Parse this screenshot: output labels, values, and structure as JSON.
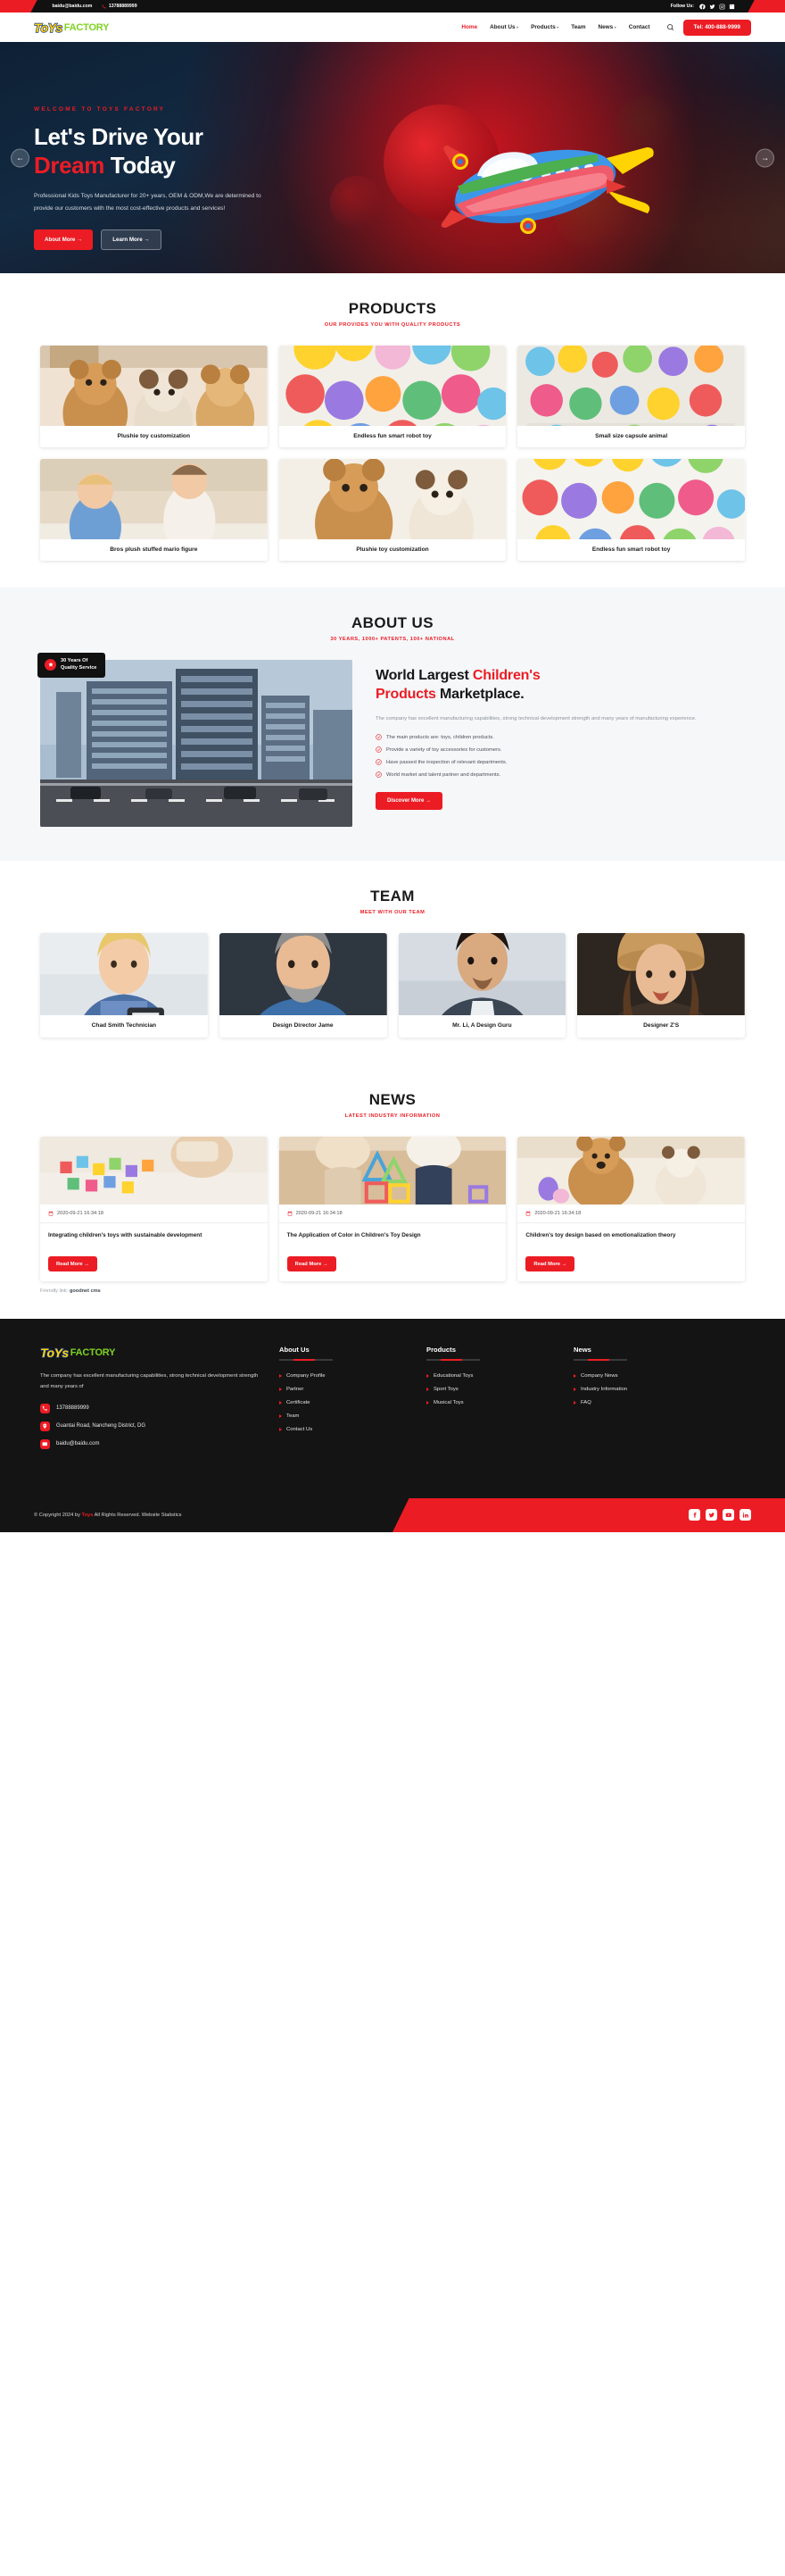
{
  "topbar": {
    "email": "baidu@baidu.com",
    "phone": "13788889999",
    "follow_label": "Follow Us:",
    "socials": [
      "facebook-icon",
      "twitter-icon",
      "instagram-icon",
      "linkedin-icon"
    ]
  },
  "nav": {
    "logo_toys": "ToYs",
    "logo_factory": "FACTORY",
    "items": [
      {
        "label": "Home",
        "has_caret": false,
        "active": true
      },
      {
        "label": "About Us",
        "has_caret": true,
        "active": false
      },
      {
        "label": "Products",
        "has_caret": true,
        "active": false
      },
      {
        "label": "Team",
        "has_caret": false,
        "active": false
      },
      {
        "label": "News",
        "has_caret": true,
        "active": false
      },
      {
        "label": "Contact",
        "has_caret": false,
        "active": false
      }
    ],
    "tel_button": "Tel: 400-888-9999"
  },
  "hero": {
    "eyebrow": "WELCOME TO TOYS FACTORY",
    "title_line1": "Let's Drive Your",
    "title_red": "Dream",
    "title_rest": " Today",
    "paragraph": "Professional Kids Toys Manufacturer for 20+ years, OEM & ODM,We are determined to provide our customers with the most cost-effective products and services!",
    "btn_primary": "About More →",
    "btn_ghost": "Learn More →",
    "prev_icon": "arrow-left-icon",
    "next_icon": "arrow-right-icon"
  },
  "products": {
    "title": "PRODUCTS",
    "subtitle": "OUR PROVIDES YOU WITH QUALITY PRODUCTS",
    "items": [
      {
        "caption": "Plushie toy customization"
      },
      {
        "caption": "Endless fun smart robot toy"
      },
      {
        "caption": "Small size capsule animal"
      },
      {
        "caption": "Bros plush stuffed mario figure"
      },
      {
        "caption": "Plushie toy customization"
      },
      {
        "caption": "Endless fun smart robot toy"
      }
    ]
  },
  "about": {
    "title": "ABOUT US",
    "subtitle": "30 YEARS, 1000+ PATENTS, 100+ NATIONAL",
    "badge_line1": "30 Years Of",
    "badge_line2": "Quality Service",
    "heading_1": "World Largest ",
    "heading_red_1": "Children's",
    "heading_red_2": "Products",
    "heading_2": " Marketplace.",
    "paragraph": "The company has excellent manufacturing capabilities, strong technical development strength and many years of manufacturing experience.",
    "bullets": [
      "The main products are: toys, children products.",
      "Provide a variety of toy accessories for customers.",
      "Have passed the inspection of relevant departments.",
      "World market and talent partner and departments."
    ],
    "button": "Discover More →"
  },
  "team": {
    "title": "TEAM",
    "subtitle": "MEET WITH OUR TEAM",
    "members": [
      {
        "name": "Chad Smith Technician"
      },
      {
        "name": "Design Director Jame"
      },
      {
        "name": "Mr. Li, A Design Guru"
      },
      {
        "name": "Designer Z'S"
      }
    ]
  },
  "news": {
    "title": "NEWS",
    "subtitle": "LATEST INDUSTRY INFORMATION",
    "items": [
      {
        "date": "2020-09-21 16:34:18",
        "title": "Integrating children's toys with sustainable development",
        "button": "Read More →"
      },
      {
        "date": "2020-09-21 16:34:18",
        "title": "The Application of Color in Children's Toy Design",
        "button": "Read More →"
      },
      {
        "date": "2020-09-21 16:34:18",
        "title": "Children's toy design based on emotionalization theory",
        "button": "Read More →"
      }
    ],
    "friendly_label": "Friendly link:",
    "friendly_value": "goodnet cms"
  },
  "footer": {
    "logo_toys": "ToYs",
    "logo_factory": "FACTORY",
    "description": "The company has excellent manufacturing capabilities, strong technical development strength and many years of",
    "contacts": [
      {
        "icon": "phone-icon",
        "text": "13788889999"
      },
      {
        "icon": "location-icon",
        "text": "Guantai Road, Nancheng District, DG"
      },
      {
        "icon": "mail-icon",
        "text": "baidu@baidu.com"
      }
    ],
    "columns": [
      {
        "heading": "About Us",
        "links": [
          "Company Profile",
          "Partner",
          "Certificate",
          "Team",
          "Contact Us"
        ]
      },
      {
        "heading": "Products",
        "links": [
          "Educational Toys",
          "Sport Toys",
          "Musical Toys"
        ]
      },
      {
        "heading": "News",
        "links": [
          "Company News",
          "Industry Information",
          "FAQ"
        ]
      }
    ],
    "copyright_prefix": "© Copyright 2024 by ",
    "copyright_brand": "Toys",
    "copyright_suffix": " All Rights Reserved. Website Statistics",
    "socials": [
      "facebook-icon",
      "twitter-icon",
      "youtube-icon",
      "linkedin-icon"
    ]
  },
  "colors": {
    "accent": "#ec1c24",
    "dark": "#141414",
    "logo_yellow": "#ffd400",
    "logo_blue": "#1a3a8f",
    "logo_green": "#7ed321"
  }
}
